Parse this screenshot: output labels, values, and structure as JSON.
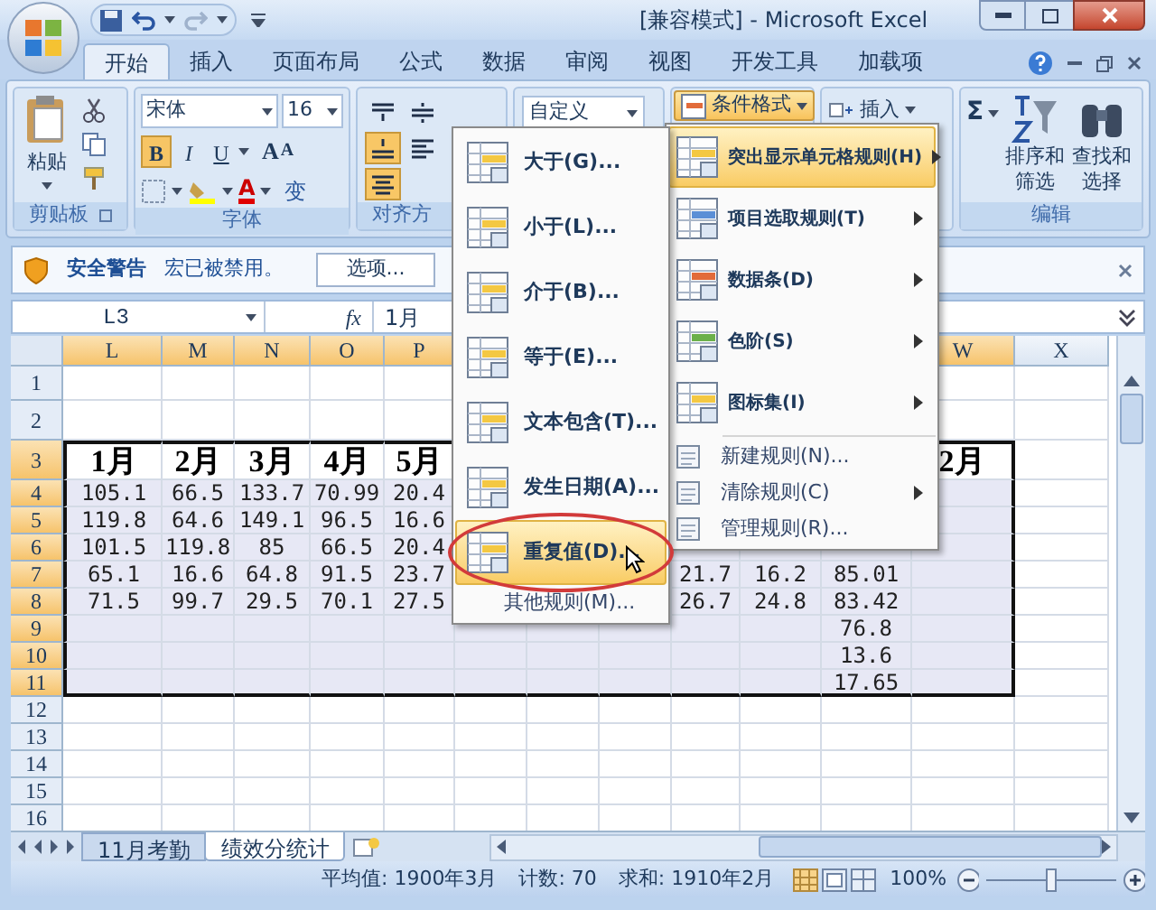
{
  "title_bar": {
    "title": "[兼容模式] - Microsoft Excel"
  },
  "ribbon_tabs": [
    {
      "label": "开始",
      "selected": true
    },
    {
      "label": "插入",
      "selected": false
    },
    {
      "label": "页面布局",
      "selected": false
    },
    {
      "label": "公式",
      "selected": false
    },
    {
      "label": "数据",
      "selected": false
    },
    {
      "label": "审阅",
      "selected": false
    },
    {
      "label": "视图",
      "selected": false
    },
    {
      "label": "开发工具",
      "selected": false
    },
    {
      "label": "加载项",
      "selected": false
    }
  ],
  "ribbon": {
    "clipboard": {
      "paste": "粘贴",
      "label": "剪贴板"
    },
    "font": {
      "family": "宋体",
      "size": "16",
      "bold": {
        "text": "B",
        "on": true
      },
      "italic": {
        "text": "I",
        "on": false
      },
      "underline": {
        "text": "U",
        "on": false
      },
      "grow": "A",
      "shrink": "A",
      "font_color": "A",
      "phonetic": "变",
      "label": "字体"
    },
    "alignment": {
      "label": "对齐方",
      "buttons": [
        {
          "kind": "top",
          "selected": false
        },
        {
          "kind": "middle",
          "selected": false
        },
        {
          "kind": "bottom",
          "selected": true
        },
        {
          "kind": "left",
          "selected": false
        },
        {
          "kind": "center",
          "selected": true
        }
      ]
    },
    "number": {
      "format": "自定义"
    },
    "styles": {
      "conditional_format": "条件格式"
    },
    "cells": {
      "insert": "插入"
    },
    "editing": {
      "sum": "Σ",
      "sort": [
        "排序和",
        "筛选"
      ],
      "find": [
        "查找和",
        "选择"
      ],
      "label": "编辑"
    }
  },
  "security_bar": {
    "title": "安全警告",
    "message": "宏已被禁用。",
    "button": "选项..."
  },
  "formula_bar": {
    "name_box": "L3",
    "function_label": "fx",
    "value": "1月"
  },
  "columns": [
    {
      "label": "L",
      "selected": true
    },
    {
      "label": "M",
      "selected": true
    },
    {
      "label": "N",
      "selected": true
    },
    {
      "label": "O",
      "selected": true
    },
    {
      "label": "P",
      "selected": true
    },
    null,
    null,
    null,
    null,
    null,
    null,
    {
      "label": "W",
      "selected": true
    },
    {
      "label": "X",
      "selected": false
    }
  ],
  "rows": [
    {
      "header": "1",
      "selected": false
    },
    {
      "header": "2",
      "selected": false
    },
    {
      "header": "3",
      "selected": true,
      "kind": "heading",
      "cells": [
        "1月",
        "2月",
        "3月",
        "4月",
        "5月",
        null,
        null,
        null,
        null,
        null,
        null,
        "2月"
      ]
    },
    {
      "header": "4",
      "selected": true,
      "kind": "data",
      "cells": [
        "105.1",
        "66.5",
        "133.7",
        "70.99",
        "20.4"
      ]
    },
    {
      "header": "5",
      "selected": true,
      "kind": "data",
      "cells": [
        "119.8",
        "64.6",
        "149.1",
        "96.5",
        "16.6"
      ]
    },
    {
      "header": "6",
      "selected": true,
      "kind": "data",
      "cells": [
        "101.5",
        "119.8",
        "85",
        "66.5",
        "20.4"
      ]
    },
    {
      "header": "7",
      "selected": true,
      "kind": "data",
      "cells": [
        "65.1",
        "16.6",
        "64.8",
        "91.5",
        "23.7",
        null,
        null,
        null,
        "21.7",
        "16.2",
        "85.01"
      ]
    },
    {
      "header": "8",
      "selected": true,
      "kind": "data",
      "cells": [
        "71.5",
        "99.7",
        "29.5",
        "70.1",
        "27.5",
        null,
        null,
        null,
        "26.7",
        "24.8",
        "83.42"
      ]
    },
    {
      "header": "9",
      "selected": true,
      "kind": "data",
      "cells": [
        null,
        null,
        null,
        null,
        null,
        null,
        null,
        null,
        null,
        null,
        "76.8"
      ]
    },
    {
      "header": "10",
      "selected": true,
      "kind": "data",
      "cells": [
        null,
        null,
        null,
        null,
        null,
        null,
        null,
        null,
        null,
        null,
        "13.6"
      ]
    },
    {
      "header": "11",
      "selected": true,
      "kind": "data",
      "cells": [
        null,
        null,
        null,
        null,
        null,
        null,
        null,
        null,
        null,
        null,
        "17.65"
      ]
    },
    {
      "header": "12",
      "selected": false
    },
    {
      "header": "13",
      "selected": false
    },
    {
      "header": "14",
      "selected": false
    },
    {
      "header": "15",
      "selected": false
    },
    {
      "header": "16",
      "selected": false
    }
  ],
  "sheet_tabs": [
    {
      "label": "11月考勤",
      "selected": false
    },
    {
      "label": "绩效分统计",
      "selected": true
    }
  ],
  "status_bar": {
    "average": "平均值: 1900年3月",
    "count": "计数: 70",
    "sum": "求和: 1910年2月",
    "zoom": "100%",
    "zoom_level": {
      "level": 0.5
    }
  },
  "conditional_menu": {
    "items": [
      {
        "label": "突出显示单元格规则(H)",
        "kind": "large",
        "selected": true,
        "submenu": true
      },
      {
        "label": "项目选取规则(T)",
        "kind": "large",
        "selected": false,
        "submenu": true
      },
      {
        "label": "数据条(D)",
        "kind": "large",
        "selected": false,
        "submenu": true
      },
      {
        "label": "色阶(S)",
        "kind": "large",
        "selected": false,
        "submenu": true
      },
      {
        "label": "图标集(I)",
        "kind": "large",
        "selected": false,
        "submenu": true
      },
      {
        "label": "新建规则(N)...",
        "kind": "small",
        "selected": false,
        "submenu": false
      },
      {
        "label": "清除规则(C)",
        "kind": "small",
        "selected": false,
        "submenu": true
      },
      {
        "label": "管理规则(R)...",
        "kind": "small",
        "selected": false,
        "submenu": false
      }
    ]
  },
  "rule_submenu": {
    "items": [
      {
        "label": "大于(G)...",
        "kind": "large",
        "selected": false
      },
      {
        "label": "小于(L)...",
        "kind": "large",
        "selected": false
      },
      {
        "label": "介于(B)...",
        "kind": "large",
        "selected": false
      },
      {
        "label": "等于(E)...",
        "kind": "large",
        "selected": false
      },
      {
        "label": "文本包含(T)...",
        "kind": "large",
        "selected": false
      },
      {
        "label": "发生日期(A)...",
        "kind": "large",
        "selected": false
      },
      {
        "label": "重复值(D)...",
        "kind": "large",
        "selected": true
      },
      {
        "label": "其他规则(M)...",
        "kind": "small",
        "selected": false
      }
    ]
  }
}
